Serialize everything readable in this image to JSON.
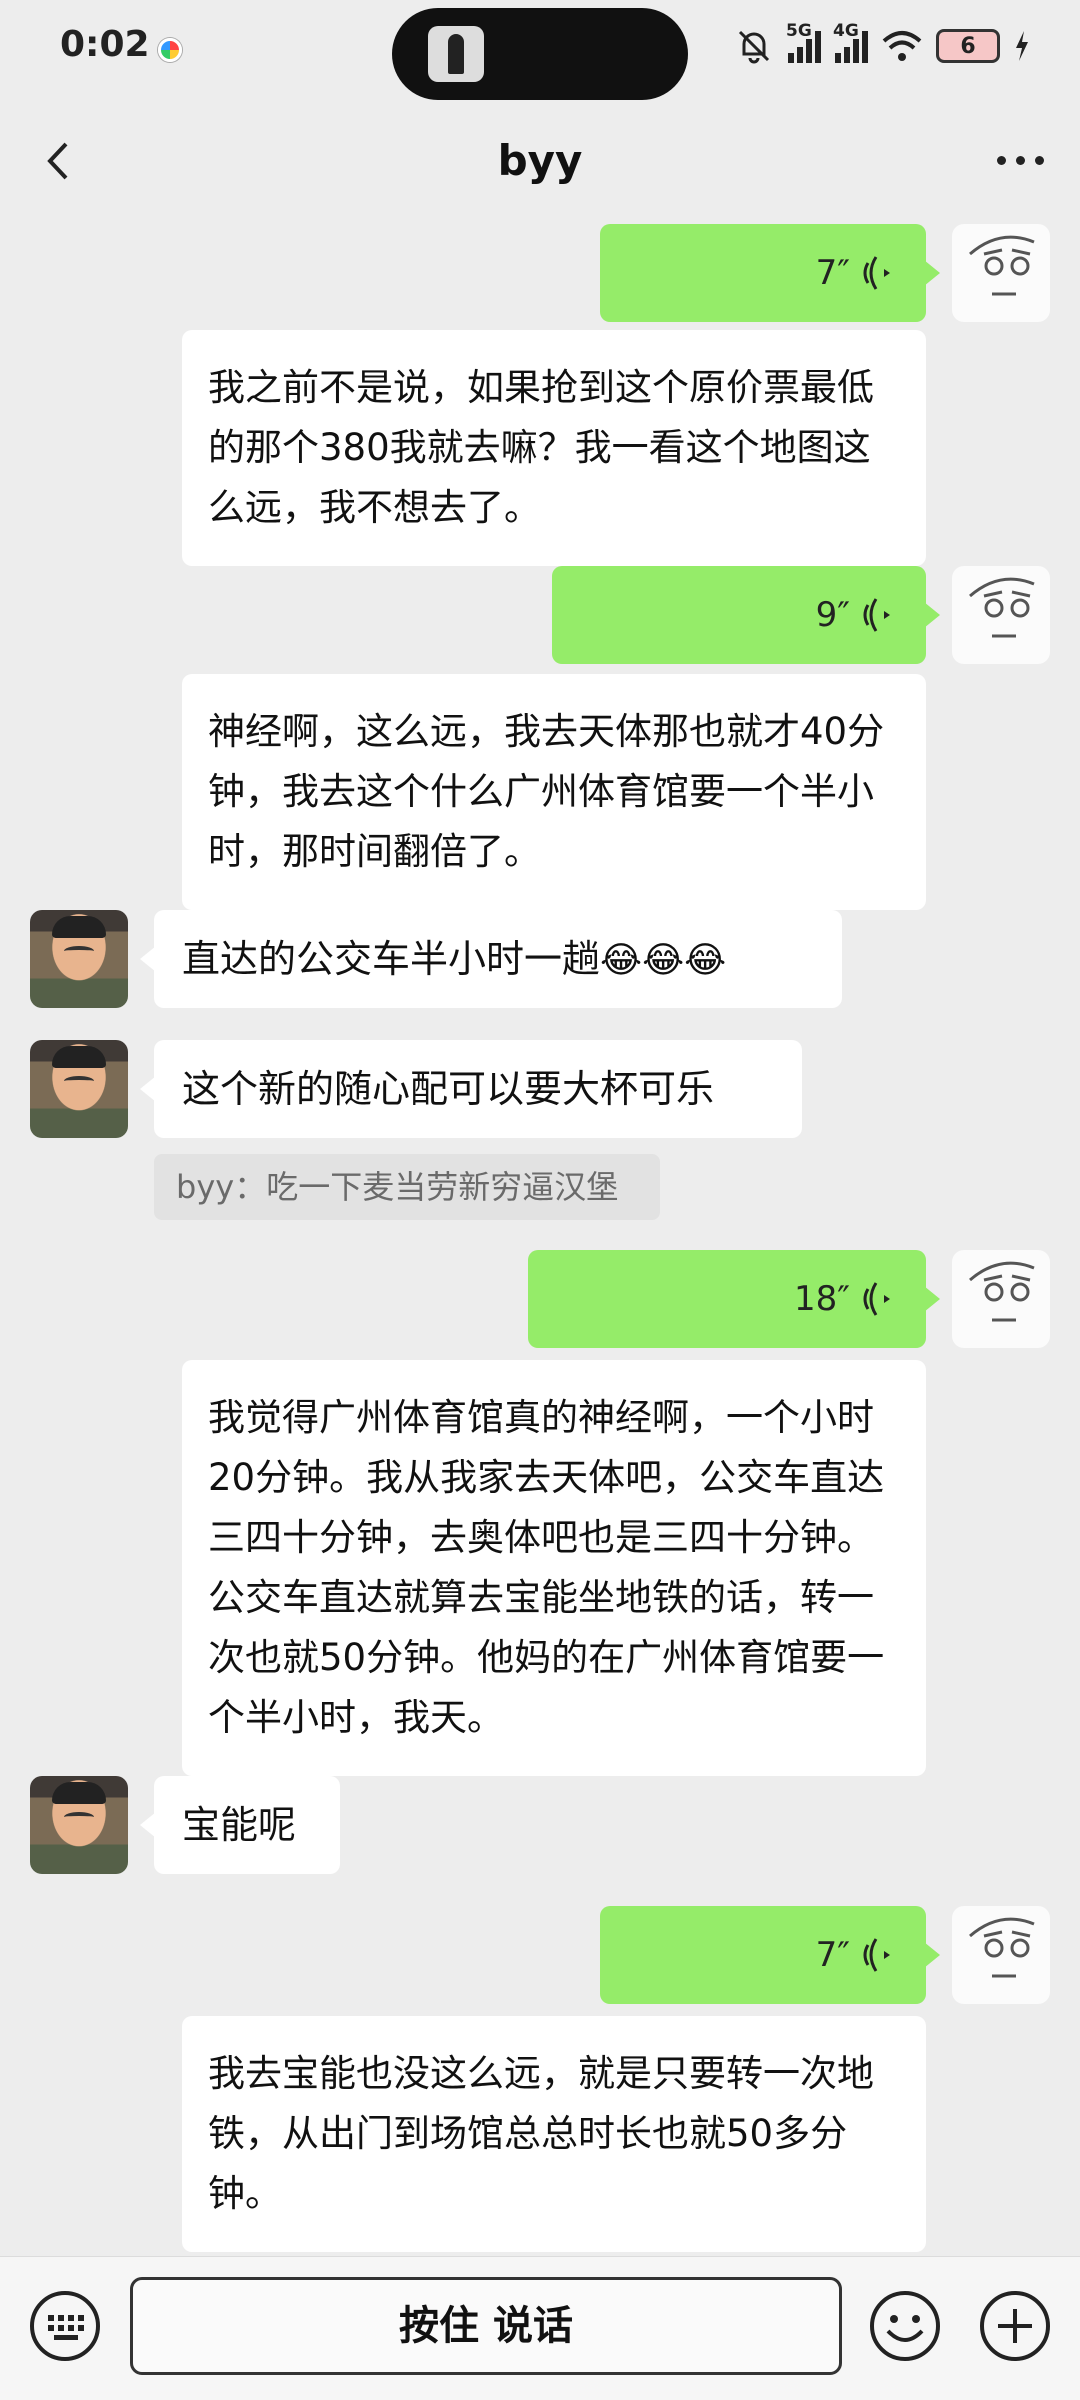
{
  "status_bar": {
    "time": "0:02",
    "network_1": "5G",
    "network_2": "4G",
    "battery": "6"
  },
  "header": {
    "title": "byy"
  },
  "messages": [
    {
      "side": "right",
      "type": "voice",
      "duration": "7″",
      "transcript": "我之前不是说，如果抢到这个原价票最低的那个380我就去嘛？我一看这个地图这么远，我不想去了。"
    },
    {
      "side": "right",
      "type": "voice",
      "duration": "9″",
      "transcript": "神经啊，这么远，我去天体那也就才40分钟，我去这个什么广州体育馆要一个半小时，那时间翻倍了。"
    },
    {
      "side": "left",
      "type": "text",
      "text": "直达的公交车半小时一趟",
      "emoji": "😂😂😂"
    },
    {
      "side": "left",
      "type": "text",
      "text": "这个新的随心配可以要大杯可乐",
      "quote": "byy：吃一下麦当劳新穷逼汉堡"
    },
    {
      "side": "right",
      "type": "voice",
      "duration": "18″",
      "transcript": "我觉得广州体育馆真的神经啊，一个小时20分钟。我从我家去天体吧，公交车直达三四十分钟，去奥体吧也是三四十分钟。公交车直达就算去宝能坐地铁的话，转一次也就50分钟。他妈的在广州体育馆要一个半小时，我天。"
    },
    {
      "side": "left",
      "type": "text",
      "text": "宝能呢"
    },
    {
      "side": "right",
      "type": "voice",
      "duration": "7″",
      "transcript": "我去宝能也没这么远，就是只要转一次地铁，从出门到场馆总总时长也就50多分钟。"
    }
  ],
  "input_bar": {
    "hold_to_talk": "按住 说话"
  },
  "colors": {
    "self_bubble": "#95ec69",
    "other_bubble": "#ffffff",
    "background": "#ededed"
  }
}
